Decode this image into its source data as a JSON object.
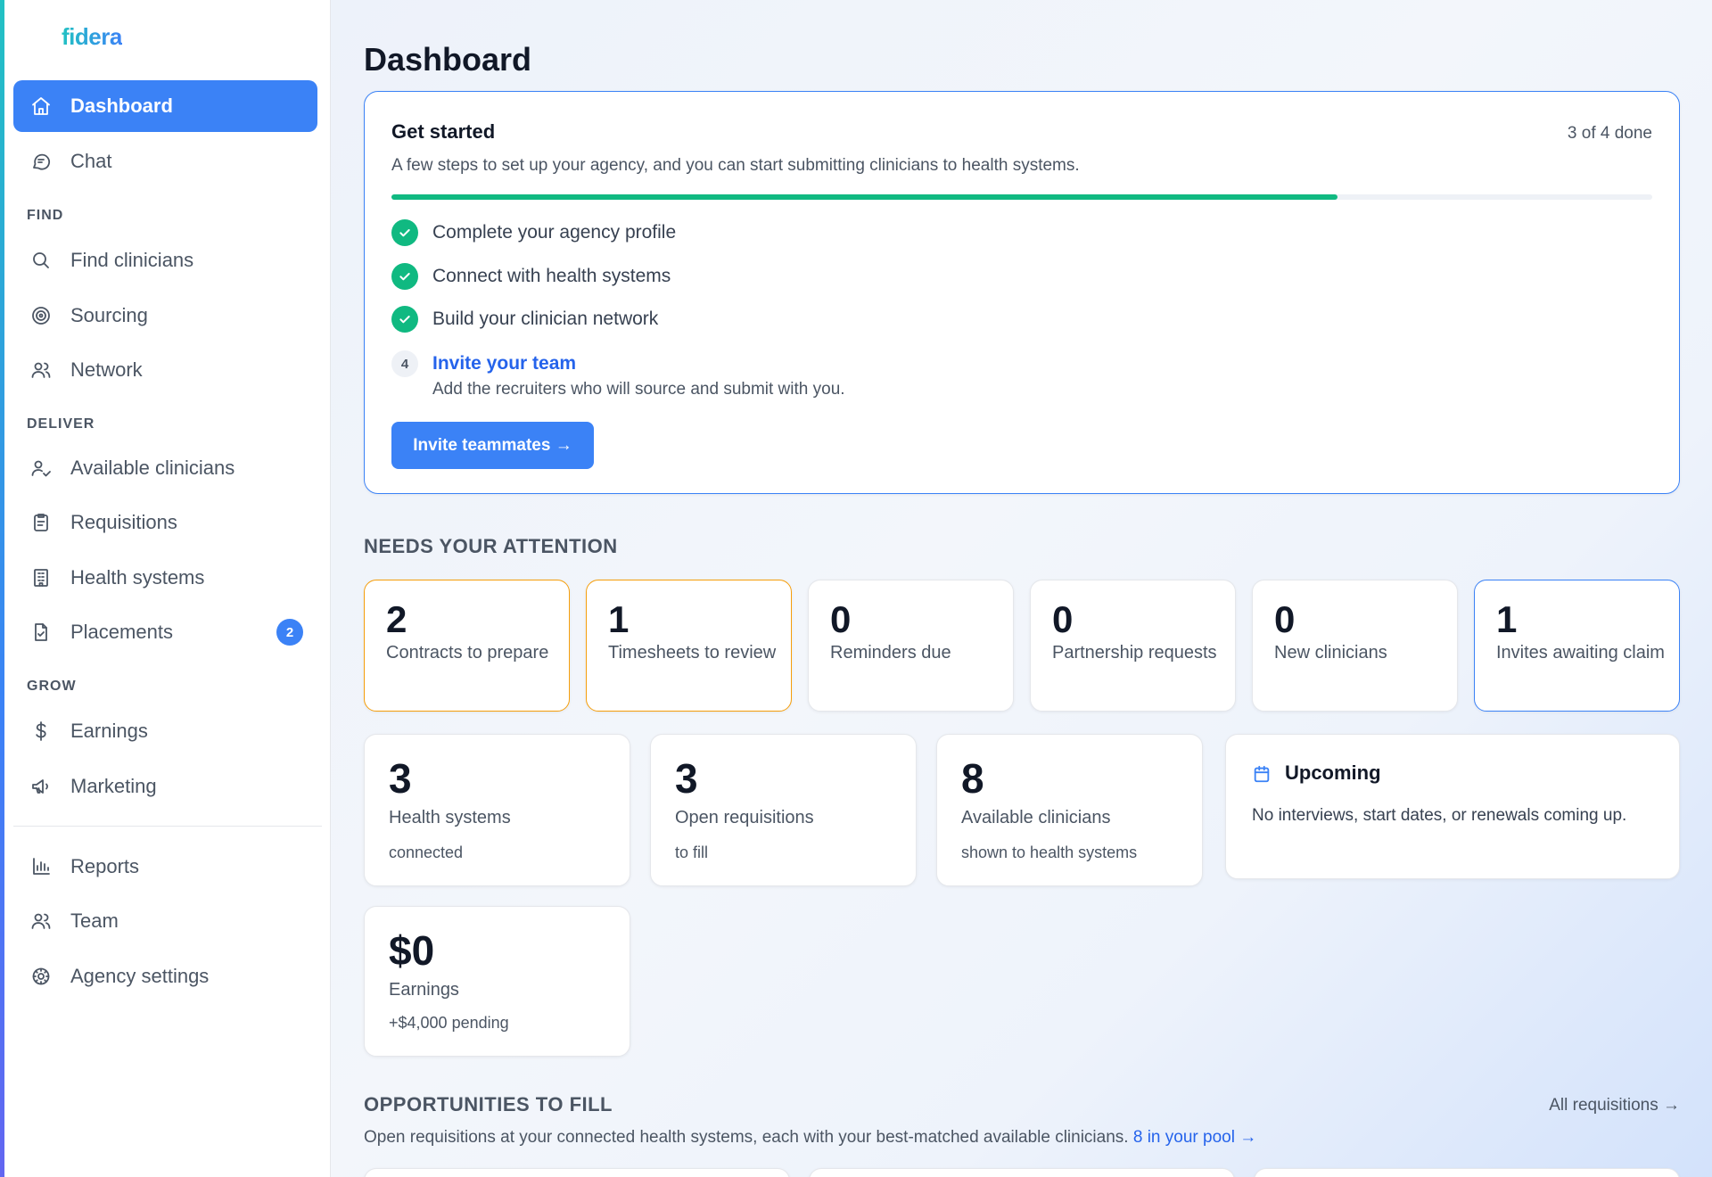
{
  "brand": {
    "logo": "fidera"
  },
  "sidebar": {
    "primary": [
      {
        "label": "Dashboard",
        "icon": "home-icon",
        "active": true
      },
      {
        "label": "Chat",
        "icon": "chat-icon"
      }
    ],
    "sections": [
      {
        "title": "FIND",
        "items": [
          {
            "label": "Find clinicians",
            "icon": "search-icon"
          },
          {
            "label": "Sourcing",
            "icon": "target-icon"
          },
          {
            "label": "Network",
            "icon": "users-icon"
          }
        ]
      },
      {
        "title": "DELIVER",
        "items": [
          {
            "label": "Available clinicians",
            "icon": "user-check-icon"
          },
          {
            "label": "Requisitions",
            "icon": "clipboard-icon"
          },
          {
            "label": "Health systems",
            "icon": "building-icon"
          },
          {
            "label": "Placements",
            "icon": "file-check-icon",
            "badge": "2"
          }
        ]
      },
      {
        "title": "GROW",
        "items": [
          {
            "label": "Earnings",
            "icon": "dollar-icon"
          },
          {
            "label": "Marketing",
            "icon": "megaphone-icon"
          }
        ]
      }
    ],
    "footer": [
      {
        "label": "Reports",
        "icon": "bar-chart-icon"
      },
      {
        "label": "Team",
        "icon": "team-icon"
      },
      {
        "label": "Agency settings",
        "icon": "settings-icon"
      }
    ]
  },
  "main": {
    "title": "Dashboard",
    "get_started": {
      "title": "Get started",
      "count": "3 of 4 done",
      "description": "A few steps to set up your agency, and you can start submitting clinicians to health systems.",
      "progress": 0.75,
      "steps": [
        {
          "label": "Complete your agency profile",
          "done": true
        },
        {
          "label": "Connect with health systems",
          "done": true
        },
        {
          "label": "Build your clinician network",
          "done": true
        },
        {
          "number": "4",
          "label": "Invite your team",
          "description": "Add the recruiters who will source and submit with you.",
          "done": false
        }
      ],
      "button": "Invite teammates →"
    },
    "attention": {
      "heading": "NEEDS YOUR ATTENTION",
      "cards": [
        {
          "value": "2",
          "label": "Contracts to prepare",
          "tone": "orange"
        },
        {
          "value": "1",
          "label": "Timesheets to review",
          "tone": "orange"
        },
        {
          "value": "0",
          "label": "Reminders due",
          "tone": "neutral"
        },
        {
          "value": "0",
          "label": "Partnership requests",
          "tone": "neutral"
        },
        {
          "value": "0",
          "label": "New clinicians",
          "tone": "neutral"
        },
        {
          "value": "1",
          "label": "Invites awaiting claim",
          "tone": "blue"
        }
      ]
    },
    "stats": [
      {
        "value": "3",
        "label": "Health systems",
        "sub": "connected"
      },
      {
        "value": "3",
        "label": "Open requisitions",
        "sub": "to fill"
      },
      {
        "value": "8",
        "label": "Available clinicians",
        "sub": "shown to health systems"
      }
    ],
    "upcoming": {
      "title": "Upcoming",
      "icon": "calendar-icon",
      "text": "No interviews, start dates, or renewals coming up."
    },
    "earnings": {
      "value": "$0",
      "label": "Earnings",
      "sub": "+$4,000 pending"
    },
    "opportunities": {
      "heading": "OPPORTUNITIES TO FILL",
      "link": "All requisitions →",
      "description": "Open requisitions at your connected health systems, each with your best-matched available clinicians.",
      "pool_link": "8 in your pool →"
    }
  },
  "colors": {
    "accent": "#3b82f6",
    "success": "#10b981",
    "warning": "#f59e0b"
  }
}
